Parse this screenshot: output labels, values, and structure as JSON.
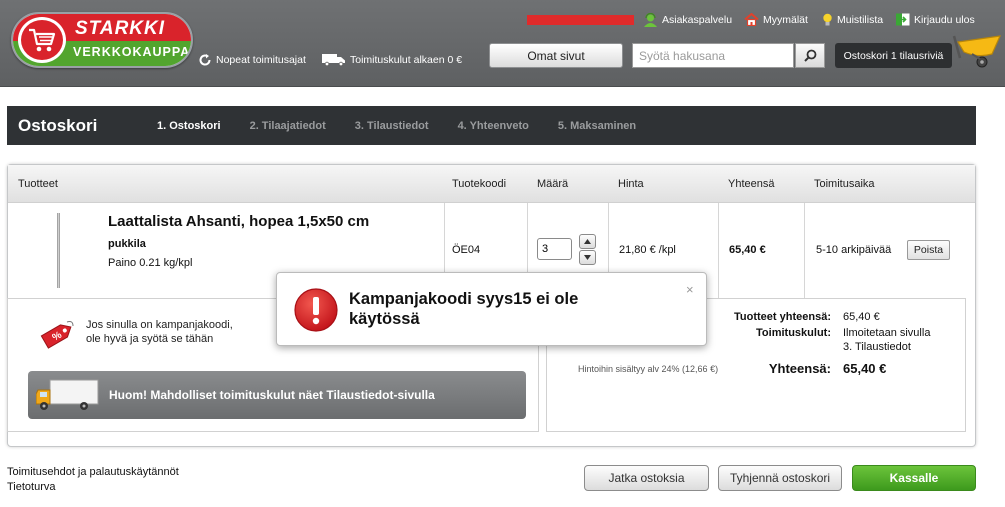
{
  "header": {
    "logo": {
      "line1": "STARKKI",
      "line2": "VERKKOKAUPPA"
    },
    "features": [
      {
        "icon": "refresh-icon",
        "label": "Nopeat toimitusajat"
      },
      {
        "icon": "truck-icon",
        "label": "Toimituskulut alkaen 0 €"
      }
    ],
    "toplinks": [
      {
        "icon": "customer-service-icon",
        "label": "Asiakaspalvelu"
      },
      {
        "icon": "home-icon",
        "label": "Myymälät"
      },
      {
        "icon": "bulb-icon",
        "label": "Muistilista"
      },
      {
        "icon": "logout-icon",
        "label": "Kirjaudu ulos"
      }
    ],
    "omat_sivut": "Omat sivut",
    "search_placeholder": "Syötä hakusana",
    "cart_button": "Ostoskori 1 tilausriviä"
  },
  "steps": {
    "title": "Ostoskori",
    "items": [
      {
        "label": "1. Ostoskori",
        "active": true
      },
      {
        "label": "2. Tilaajatiedot",
        "active": false
      },
      {
        "label": "3. Tilaustiedot",
        "active": false
      },
      {
        "label": "4. Yhteenveto",
        "active": false
      },
      {
        "label": "5. Maksaminen",
        "active": false
      }
    ]
  },
  "table": {
    "headers": [
      "Tuotteet",
      "Tuotekoodi",
      "Määrä",
      "Hinta",
      "Yhteensä",
      "Toimitusaika"
    ],
    "row": {
      "name": "Laattalista Ahsanti, hopea 1,5x50 cm",
      "brand": "pukkila",
      "weight": "Paino 0.21 kg/kpl",
      "code": "ÖE04",
      "quantity": "3",
      "price": "21,80 € /kpl",
      "total": "65,40 €",
      "delivery": "5-10 arkipäivää",
      "remove": "Poista"
    }
  },
  "campaign": {
    "text": "Jos sinulla on kampanjakoodi,\nole hyvä ja syötä se tähän"
  },
  "notice": "Huom! Mahdolliset toimituskulut näet Tilaustiedot-sivulla",
  "summary": {
    "products_label": "Tuotteet yhteensä:",
    "products_value": "65,40 €",
    "shipping_label": "Toimituskulut:",
    "shipping_value_1": "Ilmoitetaan sivulla",
    "shipping_value_2": "3. Tilaustiedot",
    "vat_note": "Hintoihin sisältyy alv 24% (12,66 €)",
    "total_label": "Yhteensä:",
    "total_value": "65,40 €"
  },
  "popup": {
    "message": "Kampanjakoodi syys15 ei ole\nkäytössä",
    "close": "×"
  },
  "footer": {
    "links": [
      "Toimitusehdot ja palautuskäytännöt",
      "Tietoturva"
    ],
    "continue": "Jatka ostoksia",
    "empty": "Tyhjennä ostoskori",
    "checkout": "Kassalle"
  }
}
